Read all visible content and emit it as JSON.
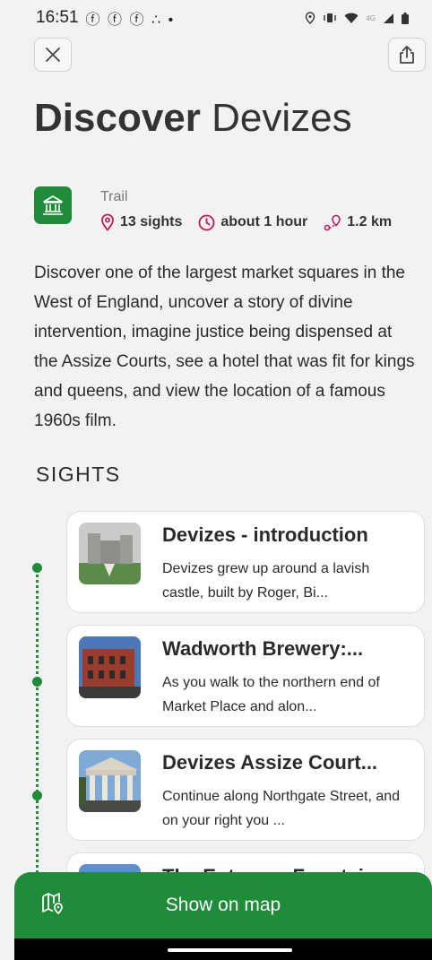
{
  "status_bar": {
    "time": "16:51",
    "left_icons": [
      "ⓕ",
      "ⓕ",
      "ⓕ",
      "∴",
      "•"
    ],
    "right_icons": [
      "location-icon",
      "vibrate-icon",
      "wifi-icon",
      "4G",
      "signal-icon",
      "battery-icon"
    ],
    "network_label": "4G"
  },
  "header": {
    "close_icon": "close-icon",
    "share_icon": "share-icon"
  },
  "title": {
    "bold": "Discover",
    "regular": "Devizes"
  },
  "trail": {
    "type_label": "Trail",
    "icon": "building-icon",
    "sights_count": "13 sights",
    "duration": "about 1 hour",
    "distance": "1.2 km",
    "accent_color": "#c2185b",
    "brand_color": "#1f8c3a"
  },
  "description": "Discover one of the largest market squares in the West of England, uncover a story of divine intervention, imagine justice being dispensed at the Assize Courts, see a hotel that was fit for kings and queens, and view the location of a famous 1960s film.",
  "sights": {
    "heading": "SIGHTS",
    "items": [
      {
        "title": "Devizes - introduction",
        "desc": "Devizes grew up around a lavish castle, built by Roger, Bi...",
        "thumb": "castle"
      },
      {
        "title": "Wadworth Brewery:...",
        "desc": "As you walk to the northern end of Market Place and alon...",
        "thumb": "brewery"
      },
      {
        "title": "Devizes Assize Court...",
        "desc": "Continue along Northgate Street, and on your right you ...",
        "thumb": "court"
      },
      {
        "title": "The Entrance Fountain",
        "desc": "",
        "thumb": "fountain"
      }
    ]
  },
  "bottom": {
    "show_map_label": "Show on map",
    "map_icon": "map-pin-icon"
  }
}
